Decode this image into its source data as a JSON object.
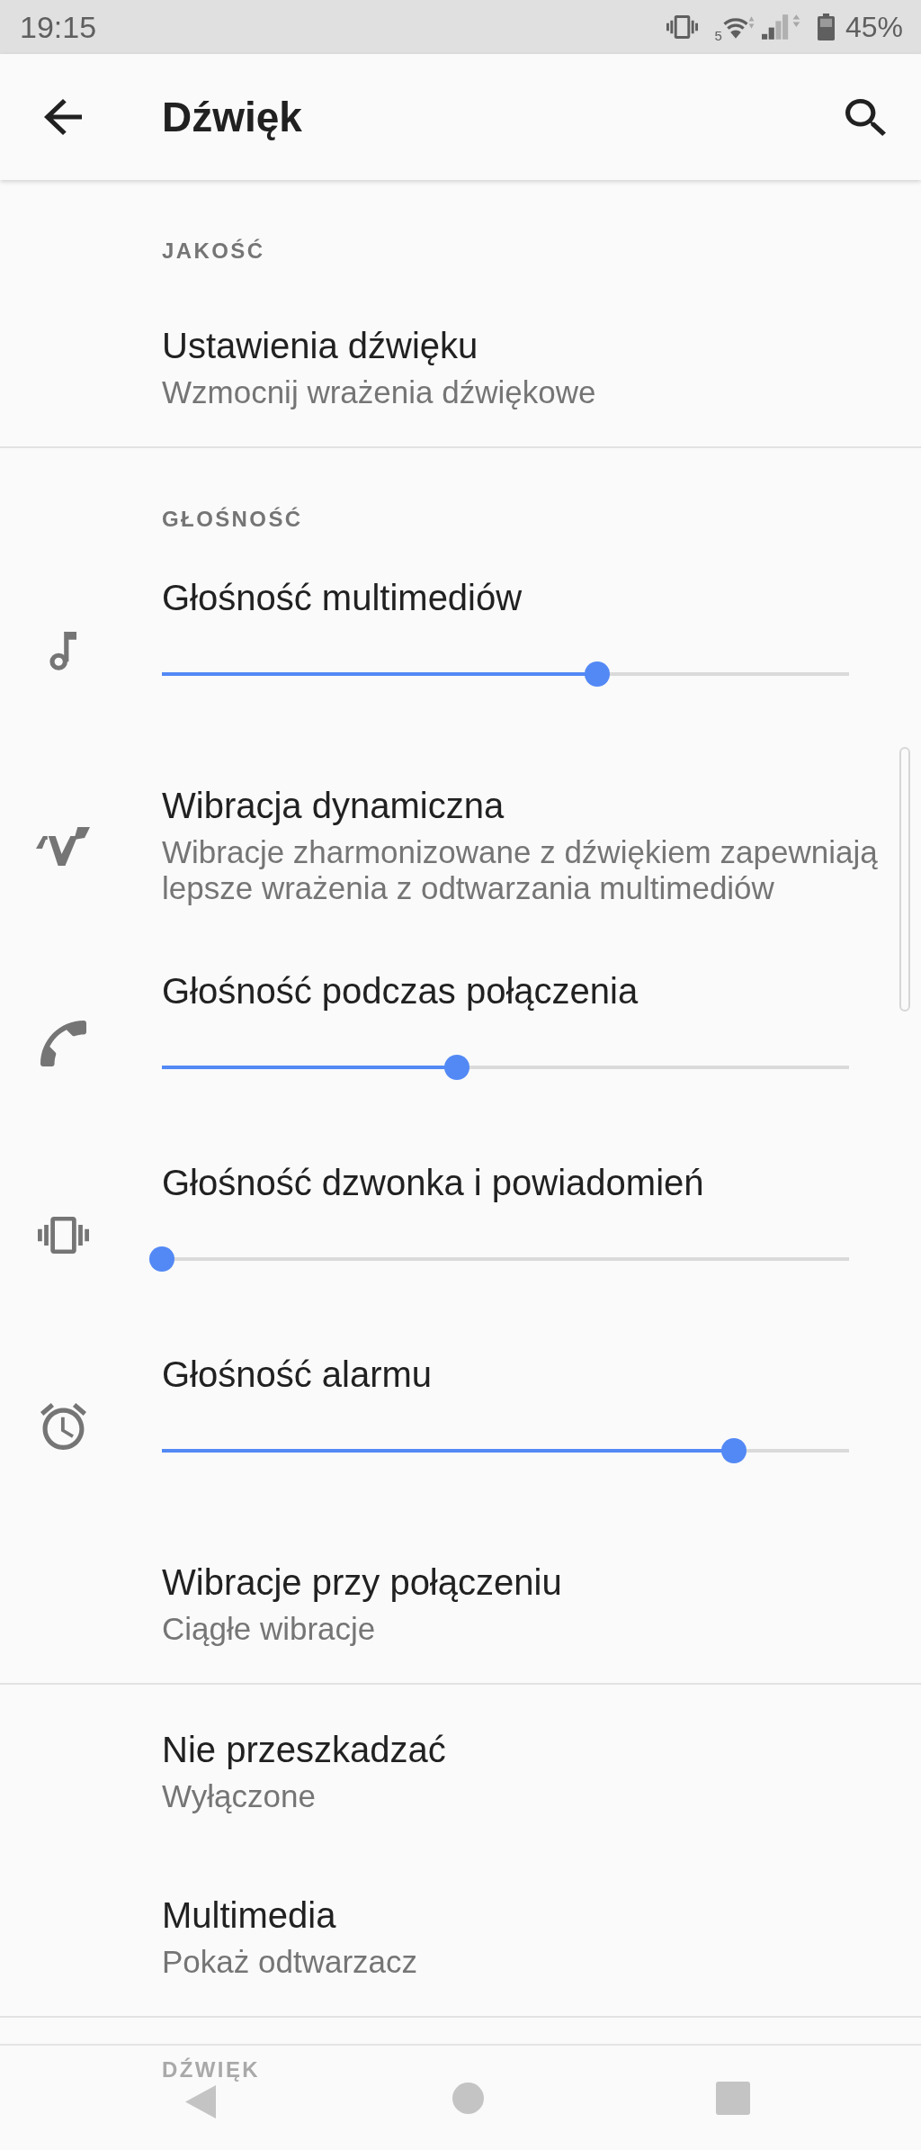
{
  "status_bar": {
    "time": "19:15",
    "wifi_band": "5",
    "battery": "45%"
  },
  "app_bar": {
    "title": "Dźwięk"
  },
  "sections": [
    {
      "header": "JAKOŚĆ",
      "items": [
        {
          "kind": "text",
          "title": "Ustawienia dźwięku",
          "summary": "Wzmocnij wrażenia dźwiękowe"
        }
      ]
    },
    {
      "header": "GŁOŚNOŚĆ",
      "items": [
        {
          "kind": "slider",
          "title": "Głośność multimediów",
          "level": 0.634
        },
        {
          "kind": "text",
          "title": "Wibracja dynamiczna",
          "summary": "Wibracje zharmonizowane z dźwiękiem zapewniają lepsze wrażenia z odtwarzania multimediów"
        },
        {
          "kind": "slider",
          "title": "Głośność podczas połączenia",
          "level": 0.429
        },
        {
          "kind": "slider",
          "title": "Głośność dzwonka i powiadomień",
          "level": 0
        },
        {
          "kind": "slider",
          "title": "Głośność alarmu",
          "level": 0.833
        },
        {
          "kind": "text",
          "title": "Wibracje przy połączeniu",
          "summary": "Ciągłe wibracje"
        }
      ]
    },
    {
      "items": [
        {
          "kind": "text",
          "title": "Nie przeszkadzać",
          "summary": "Wyłączone"
        },
        {
          "kind": "text",
          "title": "Multimedia",
          "summary": "Pokaż odtwarzacz"
        }
      ]
    },
    {
      "header": "DŹWIĘK"
    }
  ]
}
